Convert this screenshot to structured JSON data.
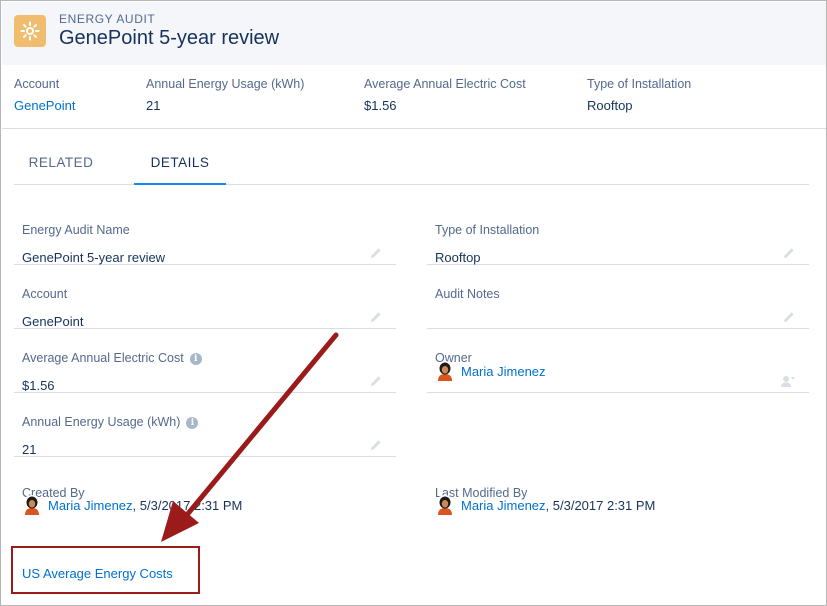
{
  "header": {
    "object_type": "ENERGY AUDIT",
    "title": "GenePoint 5-year review"
  },
  "highlights": [
    {
      "label": "Account",
      "value": "GenePoint",
      "is_link": true
    },
    {
      "label": "Annual Energy Usage (kWh)",
      "value": "21",
      "is_link": false
    },
    {
      "label": "Average Annual Electric Cost",
      "value": "$1.56",
      "is_link": false
    },
    {
      "label": "Type of Installation",
      "value": "Rooftop",
      "is_link": false
    }
  ],
  "tabs": [
    {
      "label": "RELATED",
      "active": false
    },
    {
      "label": "DETAILS",
      "active": true
    }
  ],
  "details": {
    "energy_audit_name": {
      "label": "Energy Audit Name",
      "value": "GenePoint 5-year review"
    },
    "type_of_installation": {
      "label": "Type of Installation",
      "value": "Rooftop"
    },
    "account": {
      "label": "Account",
      "value": "GenePoint"
    },
    "audit_notes": {
      "label": "Audit Notes",
      "value": ""
    },
    "avg_annual_electric_cost": {
      "label": "Average Annual Electric Cost",
      "value": "$1.56"
    },
    "owner": {
      "label": "Owner",
      "value": "Maria Jimenez"
    },
    "annual_energy_usage": {
      "label": "Annual Energy Usage (kWh)",
      "value": "21"
    },
    "created_by": {
      "label": "Created By",
      "user": "Maria Jimenez",
      "date": ", 5/3/2017 2:31 PM"
    },
    "last_modified_by": {
      "label": "Last Modified By",
      "user": "Maria Jimenez",
      "date": ", 5/3/2017 2:31 PM"
    }
  },
  "custom_link": {
    "label": "US Average Energy Costs"
  },
  "icons": {
    "object": "energy-audit-icon",
    "edit": "pencil-icon",
    "info": "info-icon",
    "change_owner": "change-owner-icon"
  },
  "colors": {
    "object_icon": "#f0bd6f",
    "link": "#0070d2",
    "annotation": "#9b1b1b",
    "active_tab": "#1589ee"
  }
}
